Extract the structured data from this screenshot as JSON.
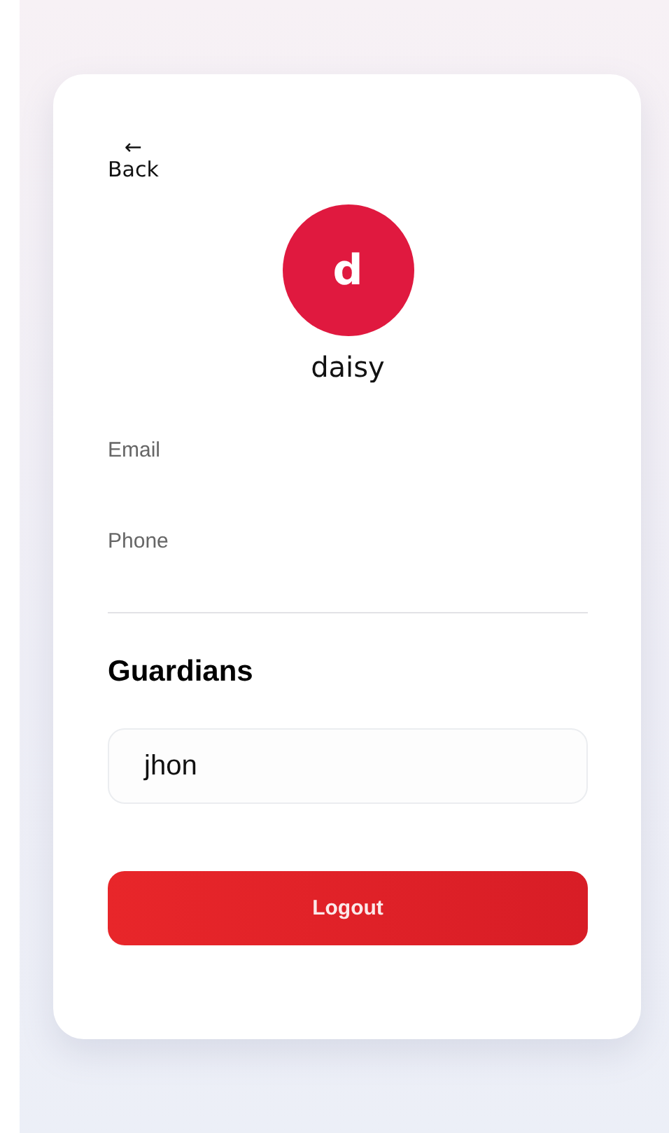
{
  "back_button": {
    "arrow": "←",
    "label": "Back"
  },
  "avatar": {
    "initial": "d",
    "color": "#e0193f"
  },
  "user_name": "daisy",
  "fields": [
    {
      "label": "Email"
    },
    {
      "label": "Phone"
    }
  ],
  "guardians": {
    "title": "Guardians",
    "items": [
      {
        "name": "jhon"
      }
    ]
  },
  "logout_button": "Logout"
}
